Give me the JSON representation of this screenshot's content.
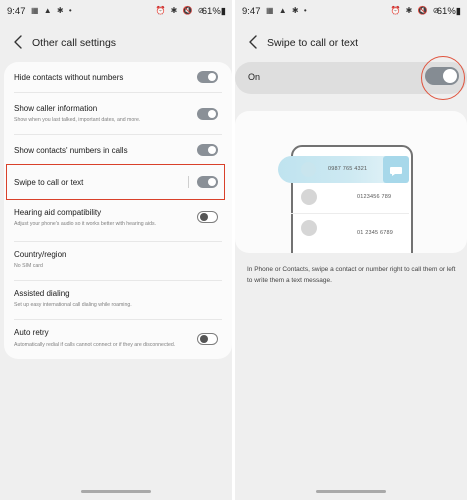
{
  "left": {
    "status": {
      "time": "9:47",
      "left_icons": "▦ ▲ ✱ •",
      "right_icons": "⏰ ✱ 🔇 ⊘",
      "battery": "61%▮"
    },
    "header": {
      "title": "Other call settings"
    },
    "settings": [
      {
        "title": "Hide contacts without numbers",
        "toggle": "on"
      },
      {
        "title": "Show caller information",
        "subtitle": "Show when you last talked, important dates, and more.",
        "toggle": "on"
      },
      {
        "title": "Show contacts' numbers in calls",
        "toggle": "on"
      },
      {
        "title": "Swipe to call or text",
        "toggle": "on",
        "highlighted": true
      },
      {
        "title": "Hearing aid compatibility",
        "subtitle": "Adjust your phone's audio so it works better with hearing aids.",
        "toggle": "off"
      },
      {
        "title": "Country/region",
        "subtitle": "No SIM card"
      },
      {
        "title": "Assisted dialing",
        "subtitle": "Set up easy international call dialing while roaming."
      },
      {
        "title": "Auto retry",
        "subtitle": "Automatically redial if calls cannot connect or if they are disconnected.",
        "toggle": "off"
      }
    ]
  },
  "right": {
    "status": {
      "time": "9:47",
      "left_icons": "▦ ▲ ✱ •",
      "right_icons": "⏰ ✱ 🔇 ⊘",
      "battery": "61%▮"
    },
    "header": {
      "title": "Swipe to call or text"
    },
    "master_switch": {
      "label": "On",
      "state": "on"
    },
    "illustration": {
      "numbers": [
        "0987 765 4321",
        "0123456 789",
        "01 2345 6789"
      ]
    },
    "description": "In Phone or Contacts, swipe a contact or number right to call them or left to write them a text message."
  },
  "colors": {
    "background": "#efefef",
    "card": "#fbfbfb",
    "toggle_on": "#8a9097",
    "highlight": "#d9412a",
    "swipe_accent": "#a7d8ea"
  },
  "icons": [
    "back-arrow-icon",
    "message-bubble-icon",
    "alarm-icon",
    "bluetooth-icon",
    "mute-icon",
    "dnd-icon",
    "battery-icon",
    "gallery-icon",
    "navigation-icon",
    "settings-icon"
  ]
}
